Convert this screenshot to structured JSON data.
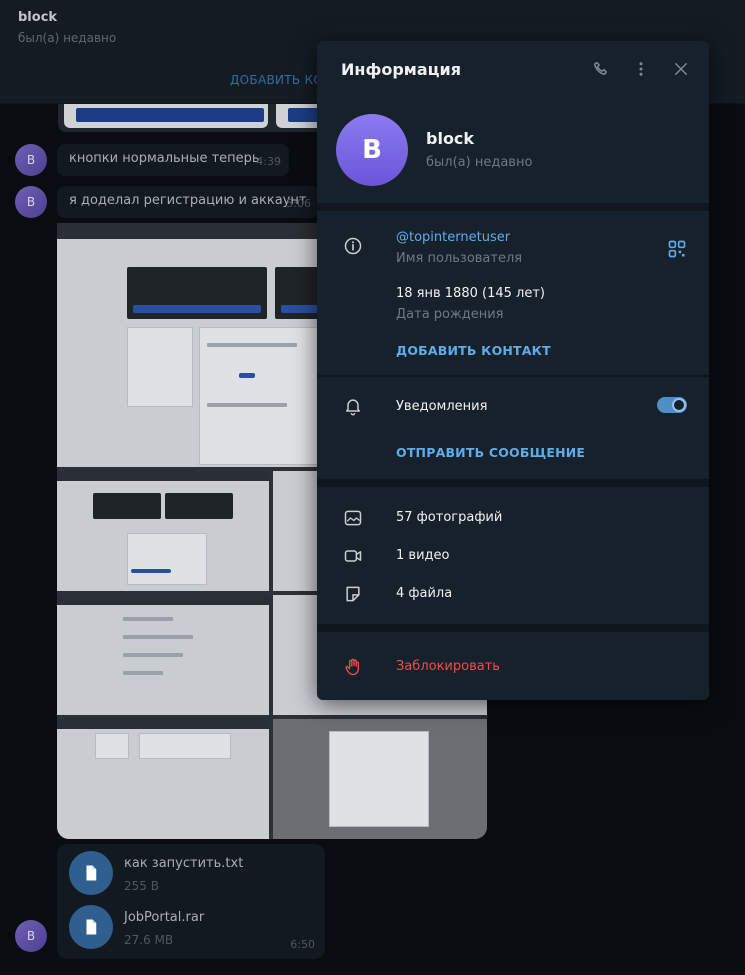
{
  "chat": {
    "name": "block",
    "status": "был(а) недавно",
    "add_contact": "ДОБАВИТЬ КО"
  },
  "messages": [
    {
      "avatar": "B",
      "text": "кнопки нормальные теперь",
      "time": "4:39"
    },
    {
      "avatar": "B",
      "text": "я доделал регистрацию и аккаунт",
      "time": "5:06"
    }
  ],
  "files": {
    "avatar": "B",
    "time": "6:50",
    "items": [
      {
        "name": "как запустить.txt",
        "size": "255 B",
        "icon": "file-icon"
      },
      {
        "name": "JobPortal.rar",
        "size": "27.6 MB",
        "icon": "file-icon"
      }
    ]
  },
  "info": {
    "title": "Информация",
    "icons": [
      "phone-icon",
      "more-vertical-icon",
      "close-icon"
    ],
    "avatar_letter": "B",
    "name": "block",
    "status": "был(а) недавно",
    "username": "@topinternetuser",
    "username_label": "Имя пользователя",
    "birthday": "18 янв 1880 (145 лет)",
    "birthday_label": "Дата рождения",
    "add_contact": "ДОБАВИТЬ КОНТАКТ",
    "notifications_label": "Уведомления",
    "notifications_on": true,
    "send_message": "ОТПРАВИТЬ СООБЩЕНИЕ",
    "media": {
      "photos": "57 фотографий",
      "videos": "1 видео",
      "files": "4 файла"
    },
    "block": "Заблокировать"
  },
  "colors": {
    "accent": "#5eacea",
    "danger": "#f14a4a",
    "panel_bg": "#17212b",
    "avatar": "#7a66e6"
  }
}
